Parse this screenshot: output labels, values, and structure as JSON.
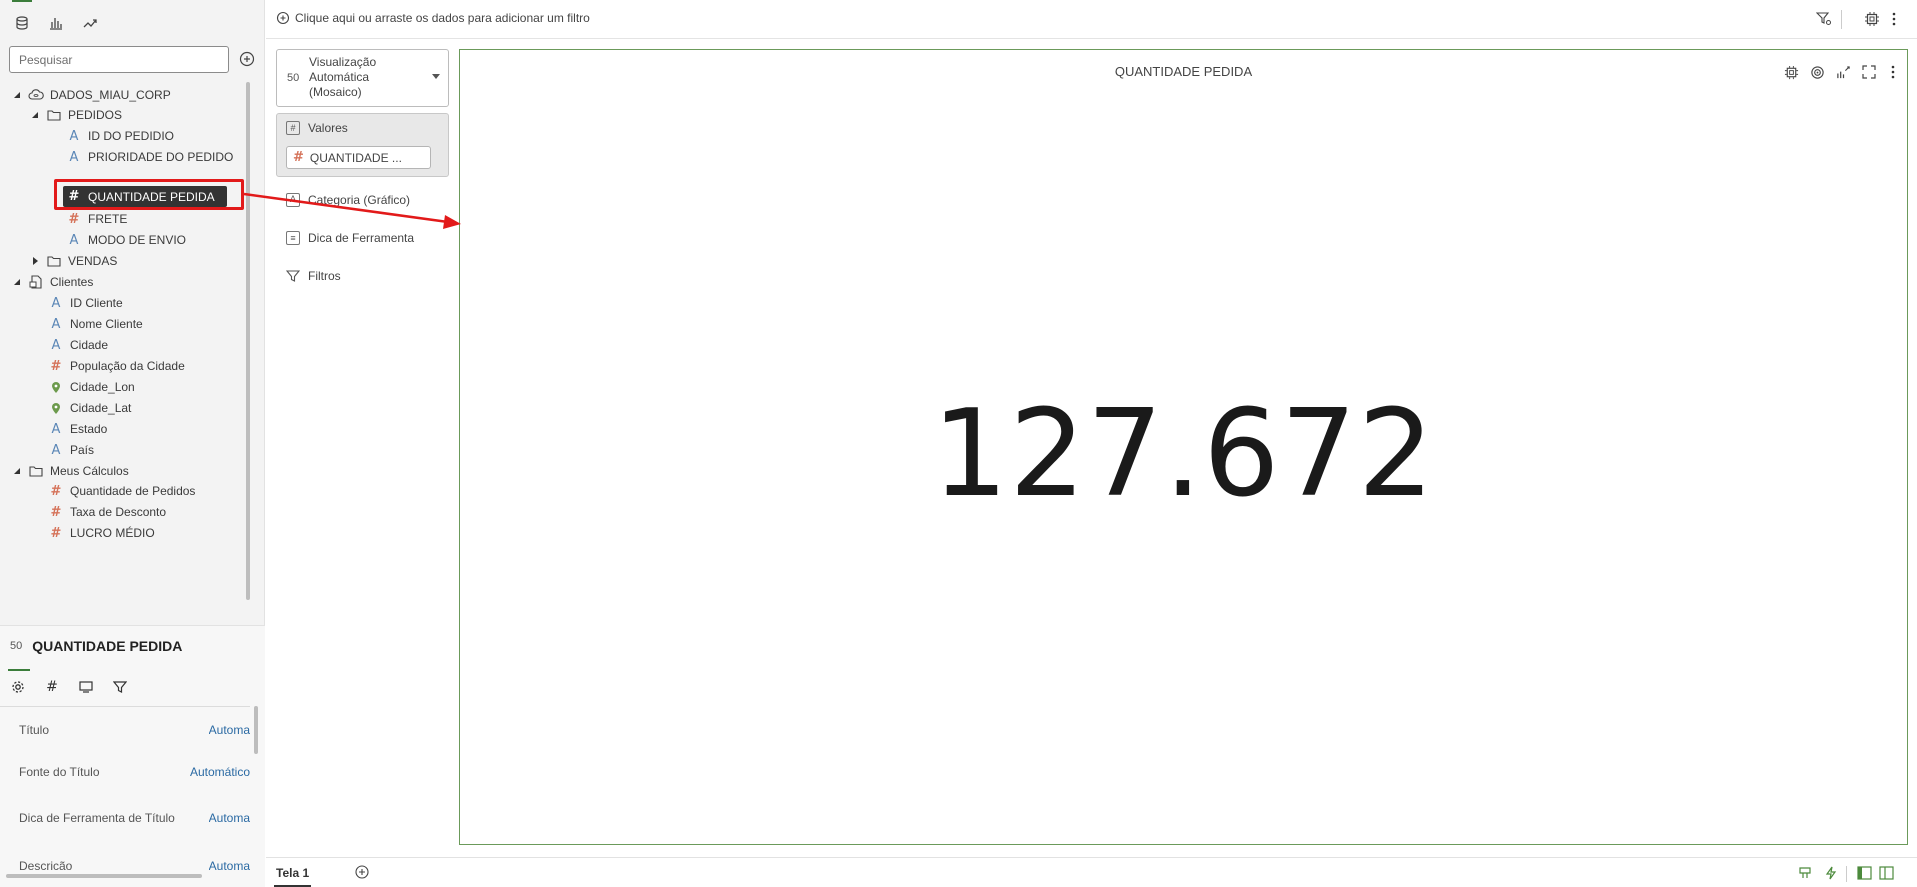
{
  "left_panel": {
    "tabs": [
      {
        "icon": "database-icon",
        "active": true
      },
      {
        "icon": "bar-chart-icon",
        "active": false
      },
      {
        "icon": "trend-icon",
        "active": false
      }
    ],
    "search": {
      "placeholder": "Pesquisar"
    },
    "tree": {
      "root": "DADOS_MIAU_CORP",
      "pedidos": "PEDIDOS",
      "pedidos_items": [
        "ID DO PEDIDIO",
        "PRIORIDADE DO PEDIDO",
        "QUANTIDADE PEDIDA",
        "FRETE",
        "MODO DE ENVIO"
      ],
      "vendas": "VENDAS",
      "clientes": "Clientes",
      "clientes_items": [
        "ID Cliente",
        "Nome Cliente",
        "Cidade",
        "População da Cidade",
        "Cidade_Lon",
        "Cidade_Lat",
        "Estado",
        "País"
      ],
      "calc": "Meus Cálculos",
      "calc_items": [
        "Quantidade de Pedidos",
        "Taxa de Desconto",
        "LUCRO MÉDIO"
      ]
    },
    "properties": {
      "title_icon_text": "50",
      "title": "QUANTIDADE PEDIDA",
      "tabs": [
        "gear-icon",
        "hash-icon",
        "screen-icon",
        "filter-icon"
      ],
      "rows": [
        {
          "label": "Título",
          "value": "Automa"
        },
        {
          "label": "Fonte do Título",
          "value": "Automático"
        },
        {
          "label": "Dica de Ferramenta de Título",
          "value": "Automa"
        },
        {
          "label": "Descrição",
          "value": "Automa"
        }
      ]
    }
  },
  "filter_bar": {
    "add_label": "Clique aqui ou arraste os dados para adicionar um filtro"
  },
  "grammar": {
    "viz_icon_text": "50",
    "viz_type": "Visualização\nAutomática\n(Mosaico)",
    "values_label": "Valores",
    "values_pill": "QUANTIDADE ...",
    "category_label": "Categoria (Gráfico)",
    "tooltip_label": "Dica de Ferramenta",
    "filters_label": "Filtros"
  },
  "canvas": {
    "title": "QUANTIDADE PEDIDA",
    "value": "127.672"
  },
  "bottom": {
    "tab_label": "Tela 1"
  }
}
